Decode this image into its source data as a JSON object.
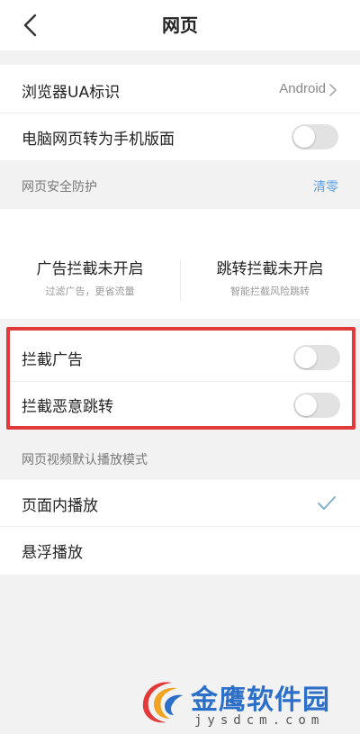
{
  "header": {
    "title": "网页",
    "back_icon": "chevron-left-icon"
  },
  "settings": {
    "ua": {
      "label": "浏览器UA标识",
      "value": "Android"
    },
    "desktop_to_mobile": {
      "label": "电脑网页转为手机版面",
      "enabled": false
    }
  },
  "security_section": {
    "header": "网页安全防护",
    "clear_label": "清零",
    "stats": [
      {
        "title": "广告拦截未开启",
        "subtitle": "过滤广告，更省流量"
      },
      {
        "title": "跳转拦截未开启",
        "subtitle": "智能拦截风险跳转"
      }
    ],
    "block_ads": {
      "label": "拦截广告",
      "enabled": false
    },
    "block_redirects": {
      "label": "拦截恶意跳转",
      "enabled": false
    }
  },
  "video_section": {
    "header": "网页视频默认播放模式",
    "options": [
      {
        "label": "页面内播放",
        "selected": true
      },
      {
        "label": "悬浮播放",
        "selected": false
      }
    ]
  },
  "watermark": {
    "name": "金鹰软件园",
    "url": "jysdcm.com"
  },
  "colors": {
    "highlight_border": "#e23a3a",
    "link": "#5aa0e6",
    "check": "#7fb2c8",
    "watermark": "#2c6fc8"
  }
}
